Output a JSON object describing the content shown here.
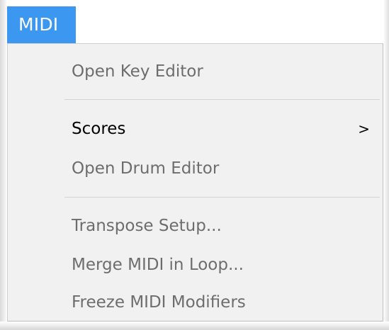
{
  "menu": {
    "title": "MIDI",
    "items": [
      {
        "label": "Open Key Editor",
        "enabled": false
      },
      {
        "label": "Scores",
        "enabled": true,
        "submenu_indicator": ">"
      },
      {
        "label": "Open Drum Editor",
        "enabled": false
      },
      {
        "label": "Transpose Setup...",
        "enabled": false
      },
      {
        "label": "Merge MIDI in Loop...",
        "enabled": false
      },
      {
        "label": "Freeze MIDI Modifiers",
        "enabled": false
      }
    ]
  },
  "colors": {
    "title_highlight": "#3b97f0",
    "menu_background": "#f1f1f1",
    "disabled_text": "#6d6d6d",
    "enabled_text": "#000000"
  }
}
